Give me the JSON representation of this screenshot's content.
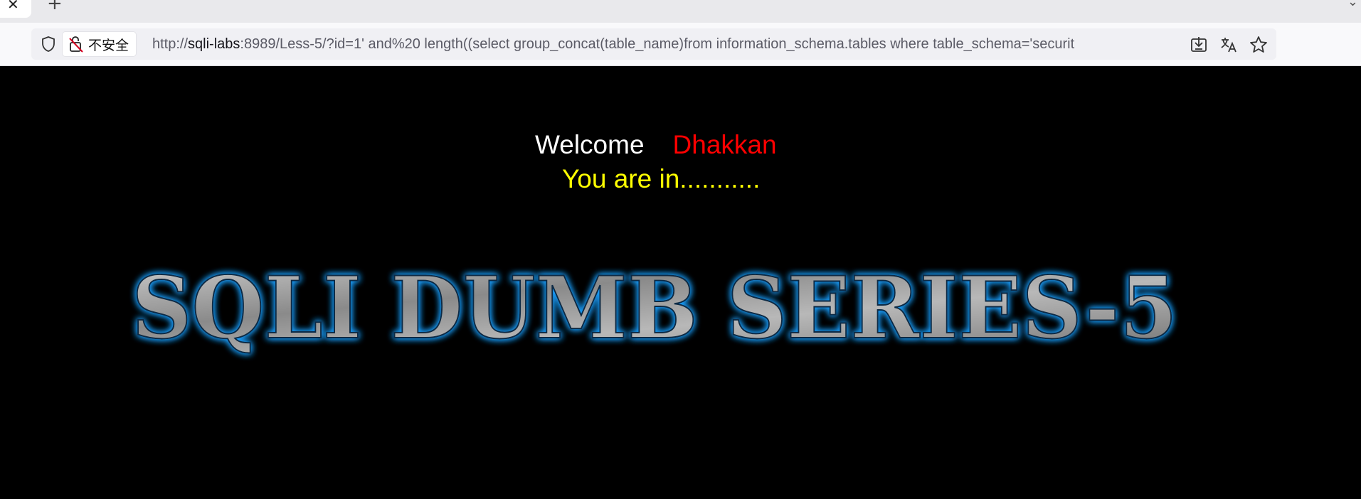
{
  "browser": {
    "tab": {
      "close_glyph": "✕"
    },
    "new_tab_glyph": "+",
    "tab_list_glyph": "⌄",
    "security": {
      "label": "不安全",
      "icon": "broken-lock-icon"
    },
    "url": {
      "scheme": "http://",
      "host": "sqli-labs",
      "rest": ":8989/Less-5/?id=1' and%20 length((select group_concat(table_name)from information_schema.tables where table_schema='securit"
    },
    "toolbar_icons": [
      "tracking-shield-icon",
      "install-app-icon",
      "translate-icon",
      "bookmark-star-icon"
    ]
  },
  "page": {
    "welcome": "Welcome",
    "name": "Dhakkan",
    "status": "You are in...........",
    "banner_text": "SQLI DUMB SERIES-5",
    "colors": {
      "background": "#000000",
      "welcome": "#ffffff",
      "name": "#ff0000",
      "status": "#ffff00",
      "banner_glow": "#1ea0ff"
    }
  }
}
